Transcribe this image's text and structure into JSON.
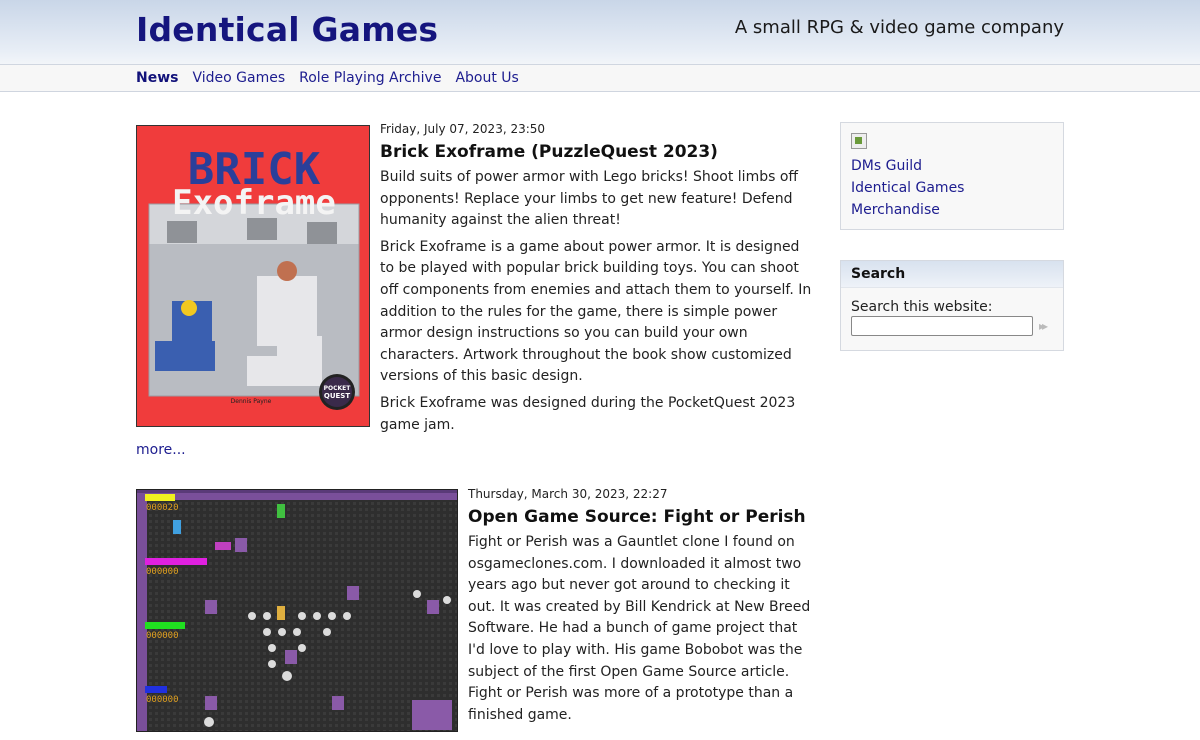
{
  "header": {
    "site_title": "Identical Games",
    "tagline": "A small RPG & video game company"
  },
  "nav": [
    {
      "label": "News",
      "active": true
    },
    {
      "label": "Video Games",
      "active": false
    },
    {
      "label": "Role Playing Archive",
      "active": false
    },
    {
      "label": "About Us",
      "active": false
    }
  ],
  "posts": [
    {
      "date": "Friday, July 07, 2023, 23:50",
      "title": "Brick Exoframe (PuzzleQuest 2023)",
      "paragraphs": [
        "Build suits of power armor with Lego bricks! Shoot limbs off opponents! Replace your limbs to get new feature! Defend humanity against the alien threat!",
        "Brick Exoframe is a game about power armor. It is designed to be played with popular brick building toys. You can shoot off components from enemies and attach them to yourself. In addition to the rules for the game, there is simple power armor design instructions so you can build your own characters. Artwork throughout the book show customized versions of this basic design.",
        "Brick Exoframe was designed during the PocketQuest 2023 game jam."
      ],
      "more": "more...",
      "cover": {
        "title_line1": "BRICK",
        "title_line2": "Exoframe",
        "author": "Dennis Payne",
        "badge_line1": "POCKET",
        "badge_line2": "QUEST"
      }
    },
    {
      "date": "Thursday, March 30, 2023, 22:27",
      "title": "Open Game Source: Fight or Perish",
      "paragraphs": [
        "Fight or Perish was a Gauntlet clone I found on osgameclones.com. I downloaded it almost two years ago but never got around to checking it out. It was created by Bill Kendrick at New Breed Software. He had a bunch of game project that I'd love to play with. His game Bobobot was the subject of the first Open Game Source article. Fight or Perish was more of a prototype than a finished game."
      ],
      "screenshot": {
        "scores": [
          "000020",
          "000000",
          "000000",
          "000000"
        ]
      }
    }
  ],
  "sidebar": {
    "links": [
      "DMs Guild",
      "Identical Games",
      "Merchandise"
    ],
    "search": {
      "heading": "Search",
      "label": "Search this website:",
      "placeholder": "",
      "go_glyph": "▸▸"
    }
  },
  "colors": {
    "link": "#1d1d8f",
    "title": "#15157e",
    "cover_red": "#f04040"
  }
}
